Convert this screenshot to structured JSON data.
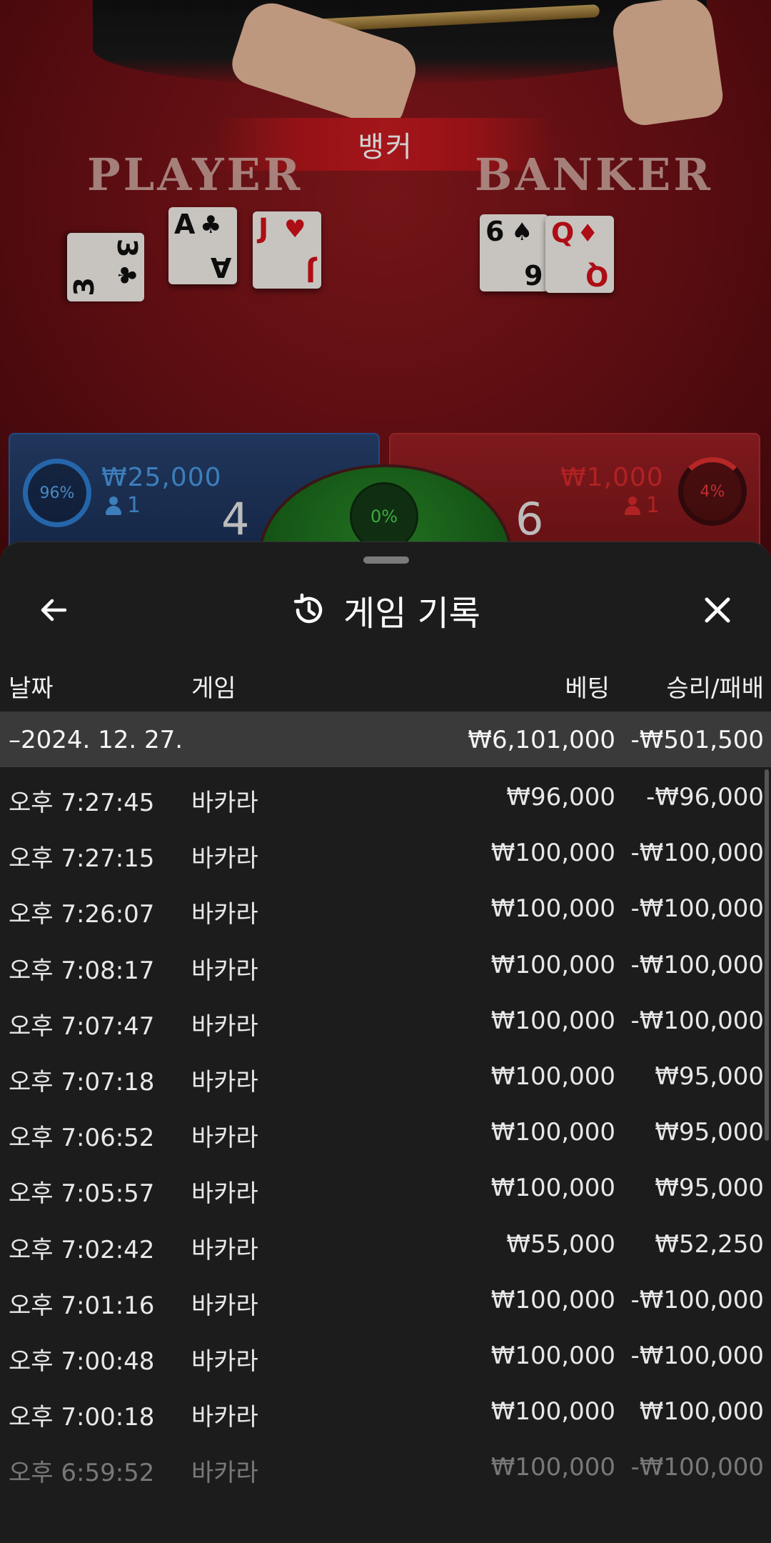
{
  "table": {
    "result_banner": "뱅커",
    "player_label": "PLAYER",
    "banker_label": "BANKER",
    "player_cards": [
      {
        "rank": "3",
        "suit": "♣",
        "color": "black"
      },
      {
        "rank": "A",
        "suit": "♣",
        "color": "black"
      },
      {
        "rank": "J",
        "suit": "♥",
        "color": "red"
      }
    ],
    "banker_cards": [
      {
        "rank": "6",
        "suit": "♠",
        "color": "black"
      },
      {
        "rank": "Q",
        "suit": "♦",
        "color": "red"
      }
    ],
    "player_bet": {
      "percent": "96%",
      "amount": "₩25,000",
      "count": "1",
      "score": "4"
    },
    "banker_bet": {
      "percent": "4%",
      "amount": "₩1,000",
      "count": "1",
      "score": "6"
    },
    "tie_percent": "0%",
    "colors": {
      "player": "#2e7dd1",
      "banker": "#d82a2a",
      "tie": "#4ad14a"
    }
  },
  "sheet": {
    "title": "게임 기록",
    "back_icon": "arrow-left-icon",
    "history_icon": "history-icon",
    "close_icon": "close-icon",
    "columns": {
      "date": "날짜",
      "game": "게임",
      "bet": "베팅",
      "win_loss": "승리/패배"
    },
    "day": {
      "date": "–2024. 12. 27.",
      "bet": "₩6,101,000",
      "win_loss": "-₩501,500"
    },
    "rows": [
      {
        "time": "오후 7:27:45",
        "game": "바카라",
        "bet": "₩96,000",
        "win_loss": "-₩96,000"
      },
      {
        "time": "오후 7:27:15",
        "game": "바카라",
        "bet": "₩100,000",
        "win_loss": "-₩100,000"
      },
      {
        "time": "오후 7:26:07",
        "game": "바카라",
        "bet": "₩100,000",
        "win_loss": "-₩100,000"
      },
      {
        "time": "오후 7:08:17",
        "game": "바카라",
        "bet": "₩100,000",
        "win_loss": "-₩100,000"
      },
      {
        "time": "오후 7:07:47",
        "game": "바카라",
        "bet": "₩100,000",
        "win_loss": "-₩100,000"
      },
      {
        "time": "오후 7:07:18",
        "game": "바카라",
        "bet": "₩100,000",
        "win_loss": "₩95,000"
      },
      {
        "time": "오후 7:06:52",
        "game": "바카라",
        "bet": "₩100,000",
        "win_loss": "₩95,000"
      },
      {
        "time": "오후 7:05:57",
        "game": "바카라",
        "bet": "₩100,000",
        "win_loss": "₩95,000"
      },
      {
        "time": "오후 7:02:42",
        "game": "바카라",
        "bet": "₩55,000",
        "win_loss": "₩52,250"
      },
      {
        "time": "오후 7:01:16",
        "game": "바카라",
        "bet": "₩100,000",
        "win_loss": "-₩100,000"
      },
      {
        "time": "오후 7:00:48",
        "game": "바카라",
        "bet": "₩100,000",
        "win_loss": "-₩100,000"
      },
      {
        "time": "오후 7:00:18",
        "game": "바카라",
        "bet": "₩100,000",
        "win_loss": "₩100,000"
      },
      {
        "time": "오후 6:59:52",
        "game": "바카라",
        "bet": "₩100,000",
        "win_loss": "-₩100,000"
      }
    ]
  }
}
